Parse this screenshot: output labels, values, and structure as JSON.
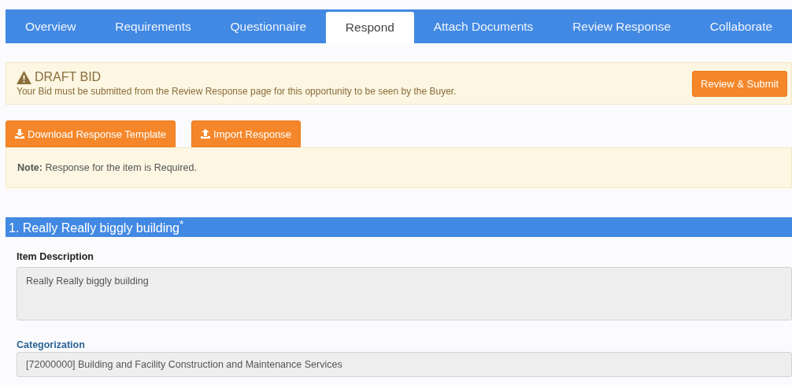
{
  "tabs": [
    {
      "label": "Overview",
      "selected": false
    },
    {
      "label": "Requirements",
      "selected": false
    },
    {
      "label": "Questionnaire",
      "selected": false
    },
    {
      "label": "Respond",
      "selected": true
    },
    {
      "label": "Attach Documents",
      "selected": false
    },
    {
      "label": "Review Response",
      "selected": false
    },
    {
      "label": "Collaborate",
      "selected": false
    }
  ],
  "draft_banner": {
    "title": "DRAFT BID",
    "message": "Your Bid must be submitted from the Review Response page for this opportunity to be seen by the Buyer.",
    "button": "Review & Submit"
  },
  "actions": [
    {
      "kind": "download",
      "label": "Download Response Template"
    },
    {
      "kind": "upload",
      "label": "Import Response"
    }
  ],
  "note": "**Note:** Response for the item is Required.",
  "item": {
    "title": "1. Really Really biggly building$^{*}$",
    "fields": [
      {
        "kind": "textarea",
        "label": "Item Description",
        "value": "Really Really biggly building"
      },
      {
        "kind": "input",
        "label": "Categorization",
        "value": "[72000000] Building and Facility Construction and Maintenance Services"
      }
    ]
  }
}
